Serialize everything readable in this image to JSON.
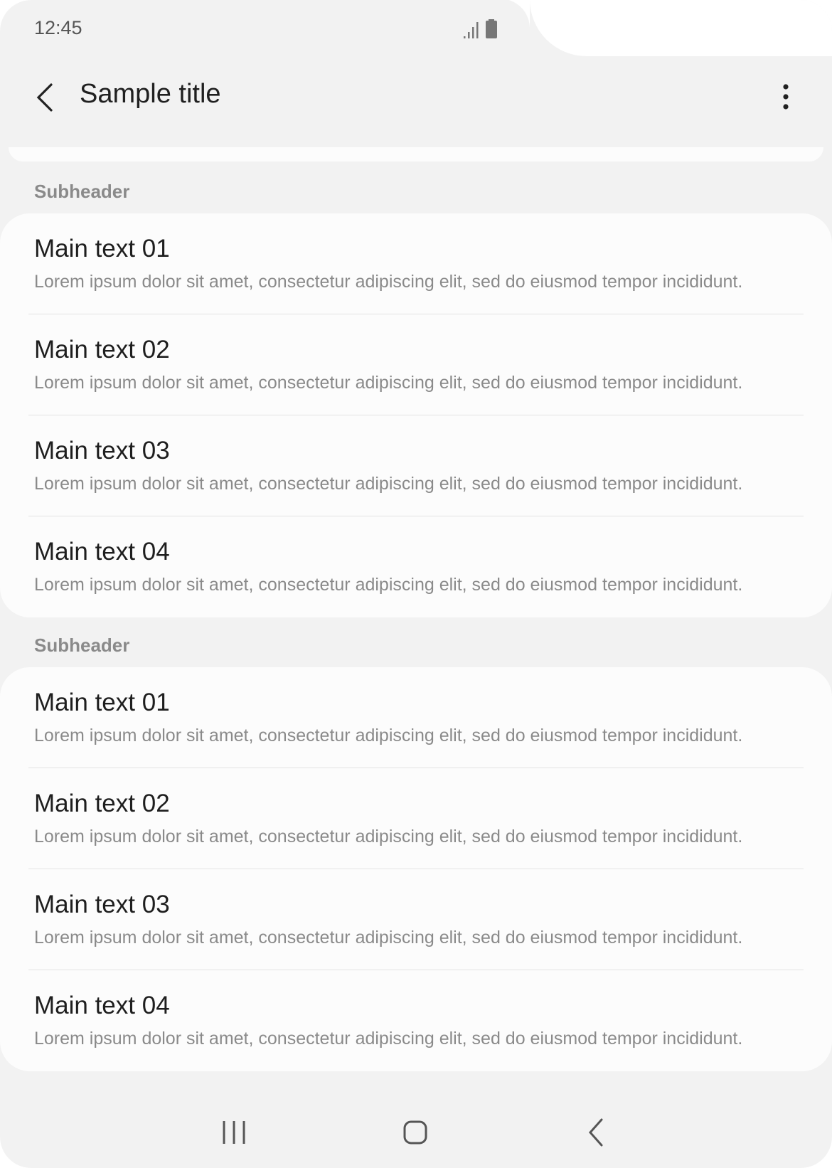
{
  "status_bar": {
    "time": "12:45",
    "icons": [
      "signal-icon",
      "battery-icon"
    ]
  },
  "app_bar": {
    "title": "Sample title",
    "back_icon": "chevron-left-icon",
    "more_icon": "more-vertical-icon"
  },
  "sections": [
    {
      "subheader": "Subheader",
      "items": [
        {
          "main": "Main text 01",
          "secondary": "Lorem ipsum dolor sit amet, consectetur adipiscing elit, sed do eiusmod tempor incididunt."
        },
        {
          "main": "Main text 02",
          "secondary": "Lorem ipsum dolor sit amet, consectetur adipiscing elit, sed do eiusmod tempor incididunt."
        },
        {
          "main": "Main text 03",
          "secondary": "Lorem ipsum dolor sit amet, consectetur adipiscing elit, sed do eiusmod tempor incididunt."
        },
        {
          "main": "Main text 04",
          "secondary": "Lorem ipsum dolor sit amet, consectetur adipiscing elit, sed do eiusmod tempor incididunt."
        }
      ]
    },
    {
      "subheader": "Subheader",
      "items": [
        {
          "main": "Main text 01",
          "secondary": "Lorem ipsum dolor sit amet, consectetur adipiscing elit, sed do eiusmod tempor incididunt."
        },
        {
          "main": "Main text 02",
          "secondary": "Lorem ipsum dolor sit amet, consectetur adipiscing elit, sed do eiusmod tempor incididunt."
        },
        {
          "main": "Main text 03",
          "secondary": "Lorem ipsum dolor sit amet, consectetur adipiscing elit, sed do eiusmod tempor incididunt."
        },
        {
          "main": "Main text 04",
          "secondary": "Lorem ipsum dolor sit amet, consectetur adipiscing elit, sed do eiusmod tempor incididunt."
        }
      ]
    }
  ],
  "nav_bar": {
    "icons": [
      "recents-icon",
      "home-icon",
      "back-icon"
    ]
  },
  "colors": {
    "background": "#f2f2f2",
    "card": "#fcfcfc",
    "primary_text": "#1e1e1e",
    "secondary_text": "#8a8a8a"
  }
}
